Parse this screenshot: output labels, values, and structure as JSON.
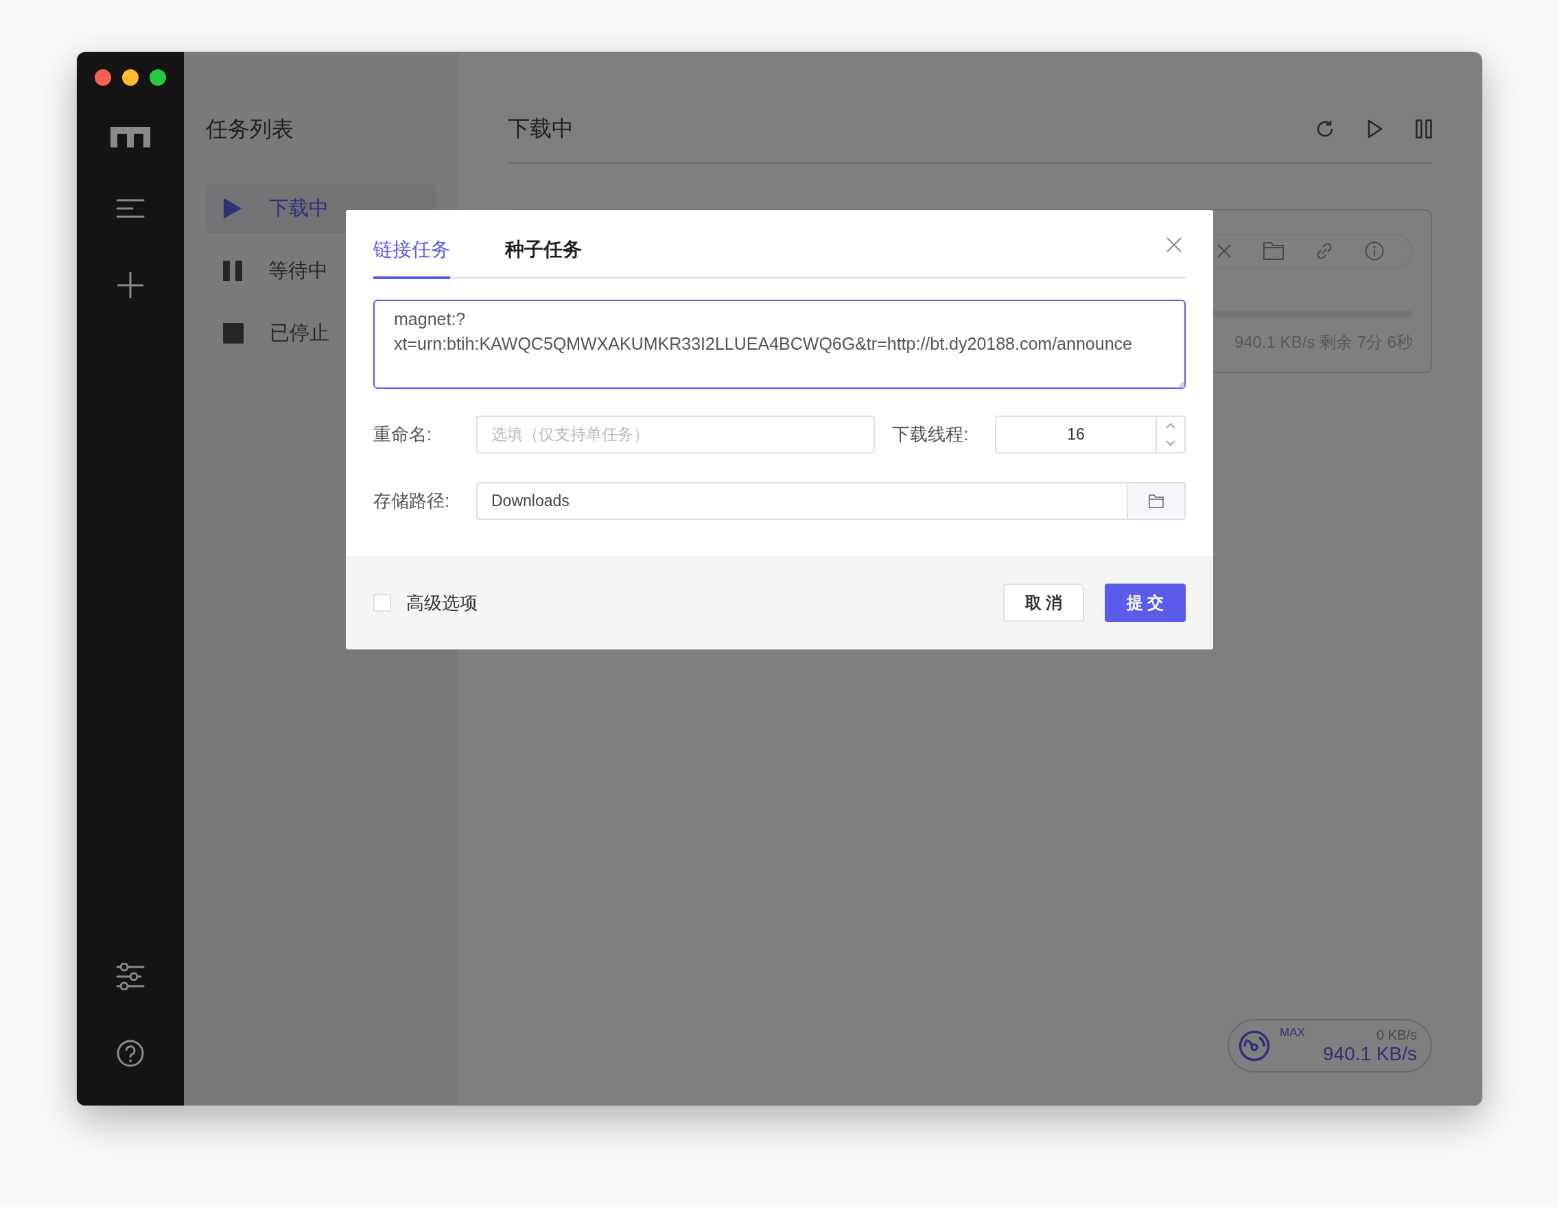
{
  "task_list": {
    "title": "任务列表",
    "items": [
      {
        "label": "下载中",
        "kind": "active",
        "selected": true
      },
      {
        "label": "等待中",
        "kind": "waiting",
        "selected": false
      },
      {
        "label": "已停止",
        "kind": "stopped",
        "selected": false
      }
    ]
  },
  "main": {
    "title": "下载中"
  },
  "task": {
    "status": "940.1 KB/s 剩余 7分 6秒"
  },
  "speed_meter": {
    "label": "MAX",
    "upload": "0 KB/s",
    "download": "940.1 KB/s"
  },
  "dialog": {
    "tabs": [
      {
        "label": "链接任务",
        "selected": true
      },
      {
        "label": "种子任务",
        "selected": false
      }
    ],
    "link_lines": [
      "magnet:?",
      "xt=urn:btih:KAWQC5QMWXAKUMKR33I2LLUEA4BCWQ6G&tr=http://bt.dy20188.com/announce"
    ],
    "rename": {
      "label": "重命名:",
      "placeholder": "选填（仅支持单任务）"
    },
    "threads": {
      "label": "下载线程:",
      "value": "16"
    },
    "path": {
      "label": "存储路径:",
      "value": "Downloads"
    },
    "advanced": {
      "label": "高级选项",
      "checked": false
    },
    "cancel": "取 消",
    "submit": "提 交"
  }
}
